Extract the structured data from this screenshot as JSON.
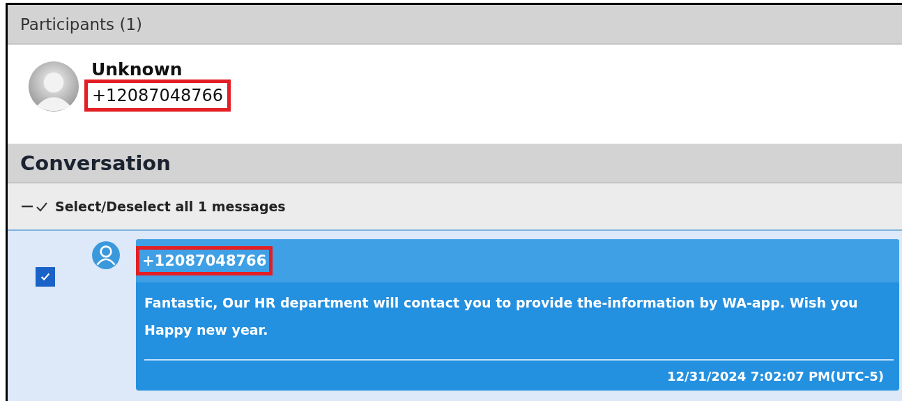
{
  "participants": {
    "title": "Participants (1)",
    "items": [
      {
        "name": "Unknown",
        "phone": "+12087048766",
        "highlighted": true
      }
    ]
  },
  "conversation": {
    "title": "Conversation",
    "select_all": {
      "label": "Select/Deselect all 1 messages"
    },
    "messages": [
      {
        "sender": "+12087048766",
        "sender_highlighted": true,
        "checked": true,
        "text": "Fantastic, Our HR department will contact you to provide the-information by WA-app. Wish you Happy new year.",
        "timestamp": "12/31/2024 7:02:07 PM(UTC-5)"
      }
    ]
  }
}
